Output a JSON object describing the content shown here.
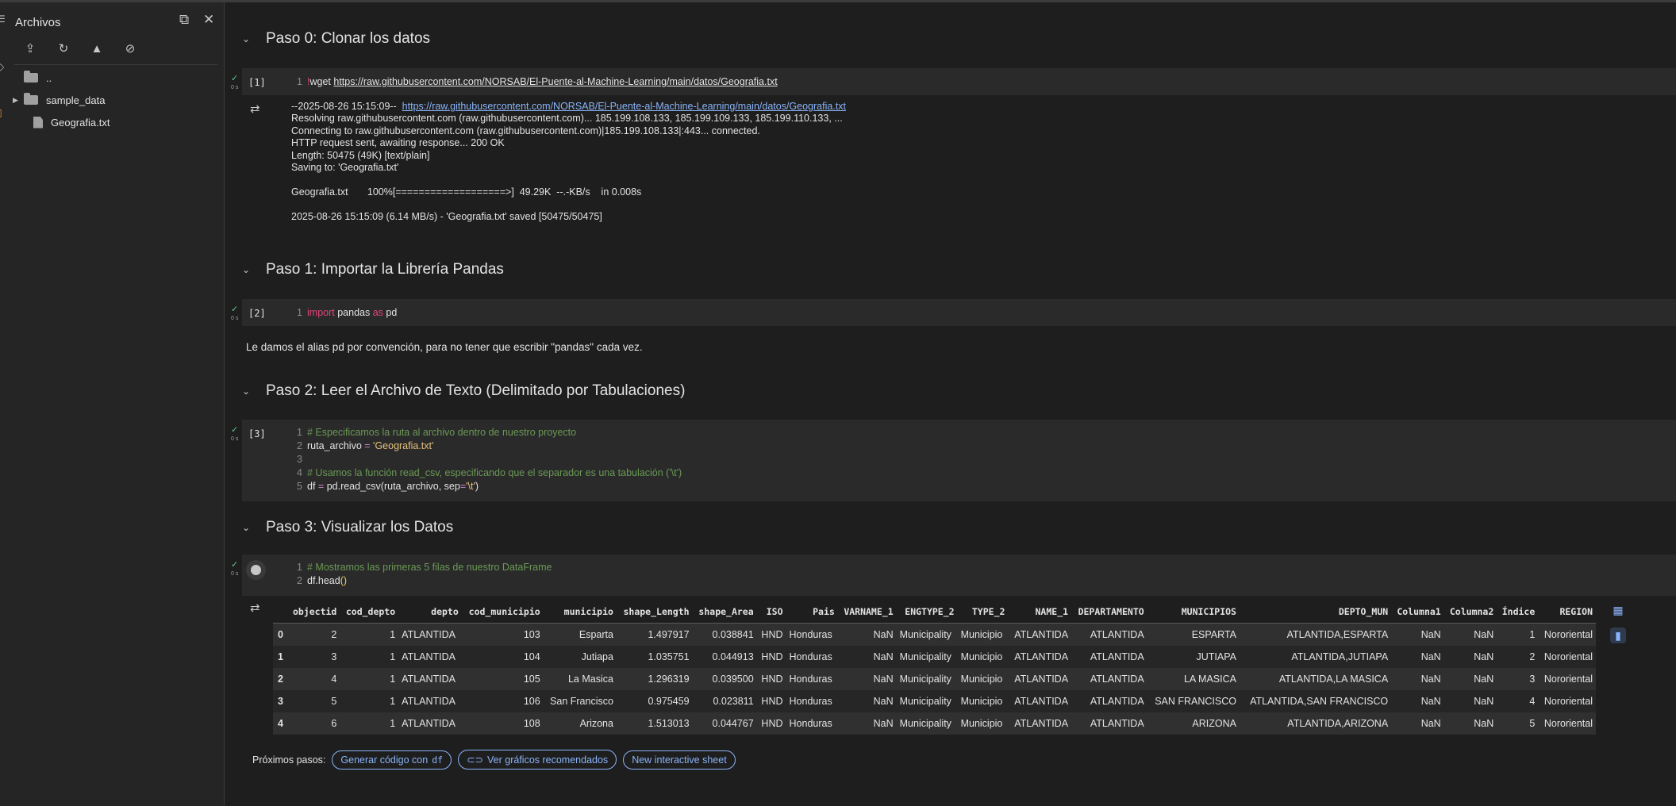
{
  "sidebar": {
    "title": "Archivos",
    "tree": [
      {
        "label": "..",
        "type": "folder",
        "expandable": false
      },
      {
        "label": "sample_data",
        "type": "folder",
        "expandable": true
      },
      {
        "label": "Geografia.txt",
        "type": "file",
        "expandable": false
      }
    ]
  },
  "sections": [
    {
      "heading": "Paso 0: Clonar los datos"
    },
    {
      "heading": "Paso 1: Importar la Librería Pandas"
    },
    {
      "heading": "Paso 2: Leer el Archivo de Texto (Delimitado por Tabulaciones)"
    },
    {
      "heading": "Paso 3: Visualizar los Datos"
    }
  ],
  "cells": {
    "c1": {
      "exec": "[1]",
      "time": "0 s",
      "ln": "1",
      "bang": "!",
      "cmd": "wget ",
      "url": "https://raw.githubusercontent.com/NORSAB/El-Puente-al-Machine-Learning/main/datos/Geografia.txt"
    },
    "c1_out": {
      "l1_prefix": "--2025-08-26 15:15:09--  ",
      "l1_url": "https://raw.githubusercontent.com/NORSAB/El-Puente-al-Machine-Learning/main/datos/Geografia.txt",
      "rest": "Resolving raw.githubusercontent.com (raw.githubusercontent.com)... 185.199.108.133, 185.199.109.133, 185.199.110.133, ...\nConnecting to raw.githubusercontent.com (raw.githubusercontent.com)|185.199.108.133|:443... connected.\nHTTP request sent, awaiting response... 200 OK\nLength: 50475 (49K) [text/plain]\nSaving to: 'Geografia.txt'\n\nGeografia.txt       100%[===================>]  49.29K  --.-KB/s    in 0.008s\n\n2025-08-26 15:15:09 (6.14 MB/s) - 'Geografia.txt' saved [50475/50475]"
    },
    "c2": {
      "exec": "[2]",
      "time": "0 s",
      "ln": "1",
      "kw1": "import",
      "mod": " pandas ",
      "kw2": "as",
      "alias": " pd"
    },
    "md1": "Le damos el alias pd por convención, para no tener que escribir \"pandas\" cada vez.",
    "c3": {
      "exec": "[3]",
      "time": "0 s",
      "ln1": "1",
      "l1": "# Especificamos la ruta al archivo dentro de nuestro proyecto",
      "ln2": "2",
      "l2_var": "ruta_archivo ",
      "l2_op": "=",
      "l2_str": " 'Geografia.txt'",
      "ln3": "3",
      "ln4": "4",
      "l4": "# Usamos la función read_csv, especificando que el separador es una tabulación ('\\t')",
      "ln5": "5",
      "l5_a": "df ",
      "l5_op": "=",
      "l5_b": " pd.read_csv(ruta_archivo, sep",
      "l5_op2": "=",
      "l5_str": "'\\t'",
      "l5_c": ")"
    },
    "c4": {
      "time": "0 s",
      "ln1": "1",
      "l1": "# Mostramos las primeras 5 filas de nuestro DataFrame",
      "ln2": "2",
      "l2_a": "df.head",
      "l2_p": "()"
    }
  },
  "dataframe": {
    "columns": [
      "objectid",
      "cod_depto",
      "depto",
      "cod_municipio",
      "municipio",
      "shape_Length",
      "shape_Area",
      "ISO",
      "Pais",
      "VARNAME_1",
      "ENGTYPE_2",
      "TYPE_2",
      "NAME_1",
      "DEPARTAMENTO",
      "MUNICIPIOS",
      "DEPTO_MUN",
      "Columna1",
      "Columna2",
      "Índice",
      "REGION"
    ],
    "rows": [
      [
        "0",
        "2",
        "1",
        "ATLANTIDA",
        "103",
        "Esparta",
        "1.497917",
        "0.038841",
        "HND",
        "Honduras",
        "NaN",
        "Municipality",
        "Municipio",
        "ATLANTIDA",
        "ATLANTIDA",
        "ESPARTA",
        "ATLANTIDA,ESPARTA",
        "NaN",
        "NaN",
        "1",
        "Nororiental"
      ],
      [
        "1",
        "3",
        "1",
        "ATLANTIDA",
        "104",
        "Jutiapa",
        "1.035751",
        "0.044913",
        "HND",
        "Honduras",
        "NaN",
        "Municipality",
        "Municipio",
        "ATLANTIDA",
        "ATLANTIDA",
        "JUTIAPA",
        "ATLANTIDA,JUTIAPA",
        "NaN",
        "NaN",
        "2",
        "Nororiental"
      ],
      [
        "2",
        "4",
        "1",
        "ATLANTIDA",
        "105",
        "La Masica",
        "1.296319",
        "0.039500",
        "HND",
        "Honduras",
        "NaN",
        "Municipality",
        "Municipio",
        "ATLANTIDA",
        "ATLANTIDA",
        "LA MASICA",
        "ATLANTIDA,LA MASICA",
        "NaN",
        "NaN",
        "3",
        "Nororiental"
      ],
      [
        "3",
        "5",
        "1",
        "ATLANTIDA",
        "106",
        "San Francisco",
        "0.975459",
        "0.023811",
        "HND",
        "Honduras",
        "NaN",
        "Municipality",
        "Municipio",
        "ATLANTIDA",
        "ATLANTIDA",
        "SAN FRANCISCO",
        "ATLANTIDA,SAN FRANCISCO",
        "NaN",
        "NaN",
        "4",
        "Nororiental"
      ],
      [
        "4",
        "6",
        "1",
        "ATLANTIDA",
        "108",
        "Arizona",
        "1.513013",
        "0.044767",
        "HND",
        "Honduras",
        "NaN",
        "Municipality",
        "Municipio",
        "ATLANTIDA",
        "ATLANTIDA",
        "ARIZONA",
        "ATLANTIDA,ARIZONA",
        "NaN",
        "NaN",
        "5",
        "Nororiental"
      ]
    ]
  },
  "next_steps": {
    "label": "Próximos pasos:",
    "gen_code": "Generar código con",
    "gen_code_var": "df",
    "charts": "Ver gráficos recomendados",
    "sheet": "New interactive sheet"
  },
  "colors": {
    "accent": "#8ab4f8",
    "success": "#5bc88b",
    "keyword": "#e0457b",
    "string": "#e5c07b",
    "comment": "#6a9955"
  }
}
